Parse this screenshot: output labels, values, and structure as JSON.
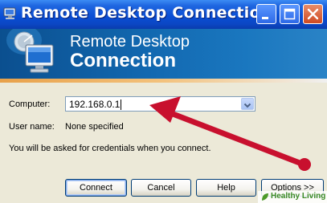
{
  "window": {
    "title": "Remote Desktop Connection"
  },
  "banner": {
    "line1": "Remote Desktop",
    "line2": "Connection"
  },
  "form": {
    "computer_label": "Computer:",
    "computer_value": "192.168.0.1",
    "username_label": "User name:",
    "username_value": "None specified",
    "credentials_note": "You will be asked for credentials when you connect."
  },
  "buttons": {
    "connect": "Connect",
    "cancel": "Cancel",
    "help": "Help",
    "options": "Options >>"
  },
  "watermark": {
    "text": "Healthy Living"
  },
  "colors": {
    "title_bar": "#0a4fd6",
    "banner": "#1268b0",
    "dialog_bg": "#ece9d8",
    "annotation_arrow": "#c8102e"
  },
  "icons": [
    "remote-desktop-icon",
    "minimize-icon",
    "maximize-icon",
    "close-icon",
    "dropdown-arrow-icon",
    "leaf-icon"
  ]
}
